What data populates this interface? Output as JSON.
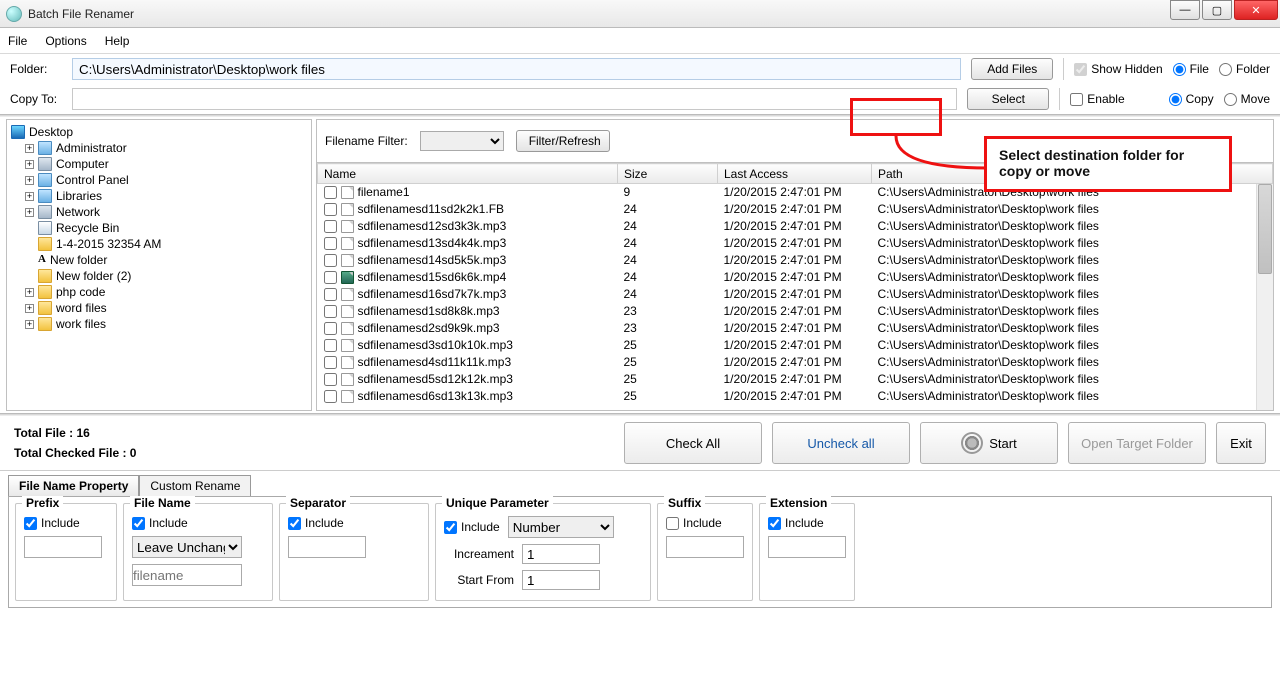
{
  "window": {
    "title": "Batch File Renamer"
  },
  "menu": {
    "file": "File",
    "options": "Options",
    "help": "Help"
  },
  "folder_row": {
    "label": "Folder:",
    "value": "C:\\Users\\Administrator\\Desktop\\work files",
    "add_files": "Add Files",
    "show_hidden": "Show Hidden",
    "file": "File",
    "folder": "Folder"
  },
  "copy_row": {
    "label": "Copy To:",
    "value": "",
    "select": "Select",
    "enable": "Enable",
    "copy": "Copy",
    "move": "Move"
  },
  "tree": [
    {
      "icon": "desktop",
      "label": "Desktop",
      "exp": "",
      "ind": 0
    },
    {
      "icon": "bluefolder",
      "label": "Administrator",
      "exp": "+",
      "ind": 1
    },
    {
      "icon": "computer",
      "label": "Computer",
      "exp": "+",
      "ind": 1
    },
    {
      "icon": "bluefolder",
      "label": "Control Panel",
      "exp": "+",
      "ind": 1
    },
    {
      "icon": "bluefolder",
      "label": "Libraries",
      "exp": "+",
      "ind": 1
    },
    {
      "icon": "computer",
      "label": "Network",
      "exp": "+",
      "ind": 1
    },
    {
      "icon": "recycle",
      "label": "Recycle Bin",
      "exp": "",
      "ind": 1
    },
    {
      "icon": "folder",
      "label": "1-4-2015 32354 AM",
      "exp": "",
      "ind": 1
    },
    {
      "icon": "newf",
      "label": "New folder",
      "exp": "",
      "ind": 1
    },
    {
      "icon": "folder",
      "label": "New folder (2)",
      "exp": "",
      "ind": 1
    },
    {
      "icon": "folder",
      "label": "php code",
      "exp": "+",
      "ind": 1
    },
    {
      "icon": "folder",
      "label": "word files",
      "exp": "+",
      "ind": 1
    },
    {
      "icon": "folder",
      "label": "work files",
      "exp": "+",
      "ind": 1
    }
  ],
  "filter": {
    "label": "Filename Filter:",
    "btn": "Filter/Refresh"
  },
  "columns": {
    "name": "Name",
    "size": "Size",
    "last": "Last Access",
    "path": "Path"
  },
  "rows": [
    {
      "name": "filename1",
      "size": "9",
      "last": "1/20/2015 2:47:01 PM",
      "path": "C:\\Users\\Administrator\\Desktop\\work files",
      "mp4": false
    },
    {
      "name": "sdfilenamesd11sd2k2k1.FB",
      "size": "24",
      "last": "1/20/2015 2:47:01 PM",
      "path": "C:\\Users\\Administrator\\Desktop\\work files",
      "mp4": false
    },
    {
      "name": "sdfilenamesd12sd3k3k.mp3",
      "size": "24",
      "last": "1/20/2015 2:47:01 PM",
      "path": "C:\\Users\\Administrator\\Desktop\\work files",
      "mp4": false
    },
    {
      "name": "sdfilenamesd13sd4k4k.mp3",
      "size": "24",
      "last": "1/20/2015 2:47:01 PM",
      "path": "C:\\Users\\Administrator\\Desktop\\work files",
      "mp4": false
    },
    {
      "name": "sdfilenamesd14sd5k5k.mp3",
      "size": "24",
      "last": "1/20/2015 2:47:01 PM",
      "path": "C:\\Users\\Administrator\\Desktop\\work files",
      "mp4": false
    },
    {
      "name": "sdfilenamesd15sd6k6k.mp4",
      "size": "24",
      "last": "1/20/2015 2:47:01 PM",
      "path": "C:\\Users\\Administrator\\Desktop\\work files",
      "mp4": true
    },
    {
      "name": "sdfilenamesd16sd7k7k.mp3",
      "size": "24",
      "last": "1/20/2015 2:47:01 PM",
      "path": "C:\\Users\\Administrator\\Desktop\\work files",
      "mp4": false
    },
    {
      "name": "sdfilenamesd1sd8k8k.mp3",
      "size": "23",
      "last": "1/20/2015 2:47:01 PM",
      "path": "C:\\Users\\Administrator\\Desktop\\work files",
      "mp4": false
    },
    {
      "name": "sdfilenamesd2sd9k9k.mp3",
      "size": "23",
      "last": "1/20/2015 2:47:01 PM",
      "path": "C:\\Users\\Administrator\\Desktop\\work files",
      "mp4": false
    },
    {
      "name": "sdfilenamesd3sd10k10k.mp3",
      "size": "25",
      "last": "1/20/2015 2:47:01 PM",
      "path": "C:\\Users\\Administrator\\Desktop\\work files",
      "mp4": false
    },
    {
      "name": "sdfilenamesd4sd11k11k.mp3",
      "size": "25",
      "last": "1/20/2015 2:47:01 PM",
      "path": "C:\\Users\\Administrator\\Desktop\\work files",
      "mp4": false
    },
    {
      "name": "sdfilenamesd5sd12k12k.mp3",
      "size": "25",
      "last": "1/20/2015 2:47:01 PM",
      "path": "C:\\Users\\Administrator\\Desktop\\work files",
      "mp4": false
    },
    {
      "name": "sdfilenamesd6sd13k13k.mp3",
      "size": "25",
      "last": "1/20/2015 2:47:01 PM",
      "path": "C:\\Users\\Administrator\\Desktop\\work files",
      "mp4": false
    }
  ],
  "status": {
    "total": "Total File :  16",
    "checked": "Total Checked File :  0"
  },
  "buttons": {
    "check_all": "Check All",
    "uncheck_all": "Uncheck all",
    "start": "Start",
    "open_target": "Open Target Folder",
    "exit": "Exit"
  },
  "tabs": {
    "t1": "File Name Property",
    "t2": "Custom Rename"
  },
  "groups": {
    "prefix": {
      "title": "Prefix",
      "include": "Include"
    },
    "filename": {
      "title": "File Name",
      "include": "Include",
      "mode": "Leave Unchange",
      "ph": "filename"
    },
    "separator": {
      "title": "Separator",
      "include": "Include"
    },
    "unique": {
      "title": "Unique Parameter",
      "include": "Include",
      "sel": "Number",
      "increament": "Increament",
      "inc_val": "1",
      "startfrom": "Start From",
      "sf_val": "1"
    },
    "suffix": {
      "title": "Suffix",
      "include": "Include"
    },
    "extension": {
      "title": "Extension",
      "include": "Include"
    }
  },
  "annotation": "Select destination folder for copy or move"
}
